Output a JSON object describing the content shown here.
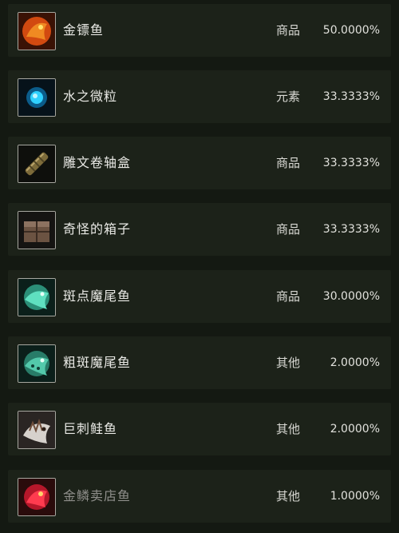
{
  "items": [
    {
      "name": "金镖鱼",
      "category": "商品",
      "percent": "50.0000%",
      "icon": "golden-dart-fish-icon"
    },
    {
      "name": "水之微粒",
      "category": "元素",
      "percent": "33.3333%",
      "icon": "water-particle-icon"
    },
    {
      "name": "雕文卷轴盒",
      "category": "商品",
      "percent": "33.3333%",
      "icon": "glyph-scroll-case-icon"
    },
    {
      "name": "奇怪的箱子",
      "category": "商品",
      "percent": "33.3333%",
      "icon": "strange-box-icon"
    },
    {
      "name": "斑点魔尾鱼",
      "category": "商品",
      "percent": "30.0000%",
      "icon": "spotted-magic-tail-fish-icon"
    },
    {
      "name": "粗斑魔尾鱼",
      "category": "其他",
      "percent": "2.0000%",
      "icon": "rough-spotted-magic-tail-fish-icon"
    },
    {
      "name": "巨刺鲑鱼",
      "category": "其他",
      "percent": "2.0000%",
      "icon": "giant-spine-salmon-icon"
    },
    {
      "name": "金鳞卖店鱼",
      "category": "其他",
      "percent": "1.0000%",
      "icon": "golden-scale-shop-fish-icon"
    }
  ],
  "colors": {
    "background": "#141912",
    "row": "#1c2219",
    "text": "#e9e9e5",
    "text_dim": "#8f8f8b"
  }
}
